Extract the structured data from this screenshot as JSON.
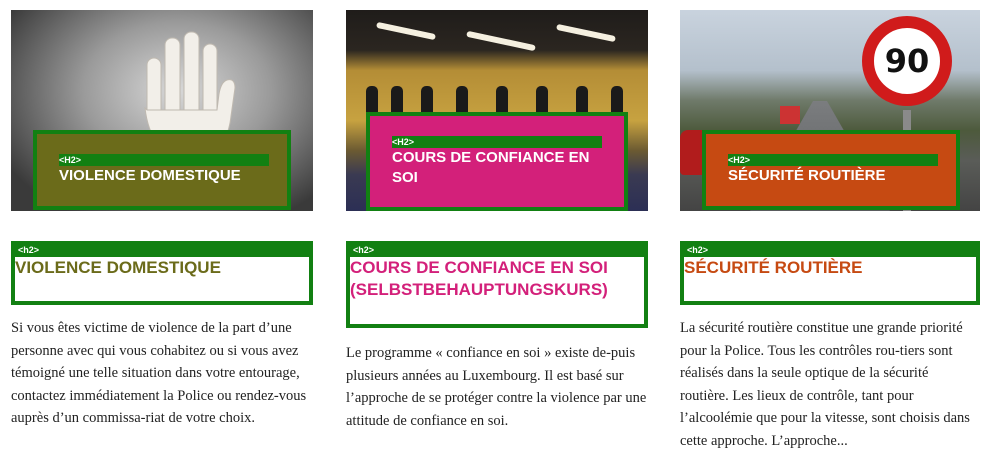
{
  "cards": [
    {
      "overlay_tag": "<H2>",
      "overlay_title": "VIOLENCE DOMESTIQUE",
      "heading_tag": "<h2>",
      "heading": "VIOLENCE DOMESTIQUE",
      "body": "Si vous êtes victime de violence de la part d’une personne avec qui vous cohabitez ou si vous avez témoigné une telle situation dans votre entourage, contactez immédiatement la Police ou rendez-vous auprès d’un commissa-riat de votre choix.",
      "accent": "#6b6b1a"
    },
    {
      "overlay_tag": "<H2>",
      "overlay_title": "COURS DE CONFIANCE EN SOI",
      "heading_tag": "<h2>",
      "heading": "COURS DE CONFIANCE EN SOI (SELBSTBEHAUPTUNGSKURS)",
      "body": "Le programme « confiance en soi » existe de-puis plusieurs années au Luxembourg. Il est basé sur l’approche de se protéger contre la violence par une attitude de confiance en soi.",
      "accent": "#d3207a"
    },
    {
      "overlay_tag": "<H2>",
      "overlay_title": "SÉCURITÉ ROUTIÈRE",
      "heading_tag": "<h2>",
      "heading": "SÉCURITÉ ROUTIÈRE",
      "body": "La sécurité routière constitue une grande priorité pour la Police. Tous les contrôles rou-tiers sont réalisés dans la seule optique de la sécurité routière. Les lieux de contrôle, tant pour l’alcoolémie que pour la vitesse, sont choisis dans cette approche. L’approche...",
      "accent": "#c64a12",
      "sign_value": "90"
    }
  ],
  "frame_color": "#128012"
}
